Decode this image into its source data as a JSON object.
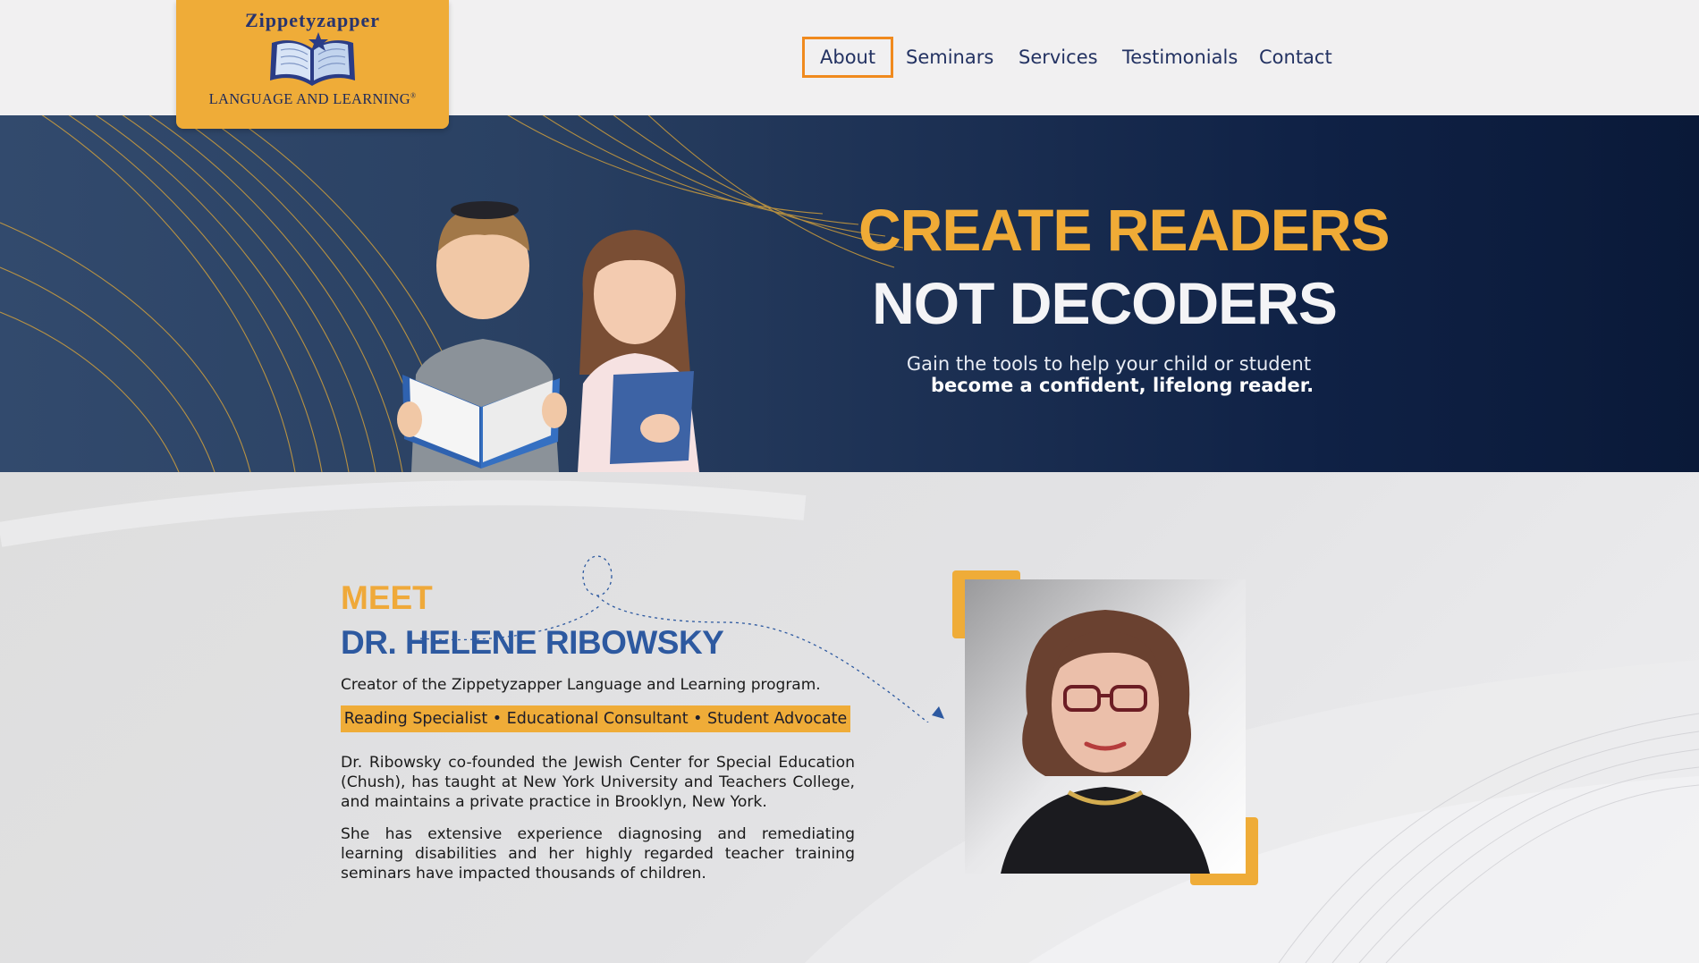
{
  "brand": {
    "name": "Zippetyzapper",
    "tagline": "LANGUAGE AND LEARNING",
    "mark": "®"
  },
  "nav": {
    "items": [
      {
        "label": "About",
        "active": true
      },
      {
        "label": "Seminars",
        "active": false
      },
      {
        "label": "Services",
        "active": false
      },
      {
        "label": "Testimonials",
        "active": false
      },
      {
        "label": "Contact",
        "active": false
      }
    ]
  },
  "hero": {
    "headline_line1": "CREATE READERS",
    "headline_line2": "NOT DECODERS",
    "subtext_line1": "Gain the tools to help your child or student",
    "subtext_line2": "become a confident, lifelong reader."
  },
  "about": {
    "eyebrow": "MEET",
    "name": "DR. HELENE RIBOWSKY",
    "creator_line": "Creator of the Zippetyzapper Language and Learning program.",
    "roles": "Reading Specialist • Educational Consultant • Student Advocate",
    "paragraph1": "Dr. Ribowsky co-founded the Jewish Center for Special Education (Chush), has taught at New York University and Teachers College, and maintains a private practice in Brooklyn, New York.",
    "paragraph2": "She has extensive experience diagnosing and remediating learning disabilities and her highly regarded teacher training seminars have impacted thousands of children."
  },
  "colors": {
    "accent_gold": "#efac38",
    "navy": "#0f2145",
    "name_blue": "#2d59a0",
    "nav_active_border": "#f08a1e",
    "nav_text": "#233262"
  }
}
